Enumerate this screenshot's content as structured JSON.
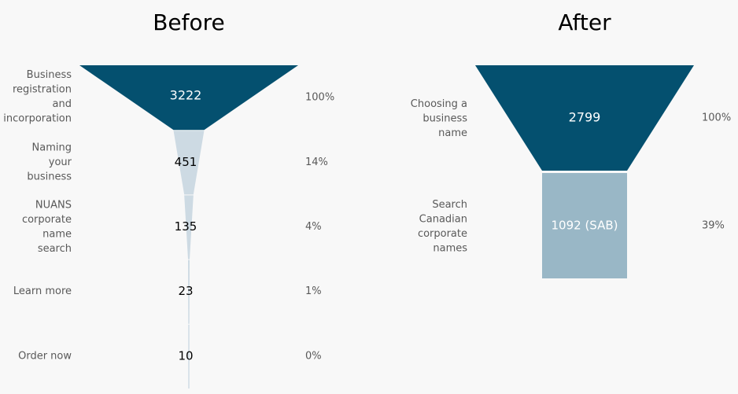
{
  "colors": {
    "dark": "#04506f",
    "light": "#cddae3",
    "medium": "#99b7c6",
    "label": "#595959",
    "background": "#f8f8f8"
  },
  "chart_data": [
    {
      "type": "funnel",
      "title": "Before",
      "stages": [
        {
          "label": "Business registration and incorporation",
          "label_lines": [
            "Business",
            "registration",
            "and",
            "incorporation"
          ],
          "value": 3222,
          "value_text": "3222",
          "percent": "100%",
          "color": "dark"
        },
        {
          "label": "Naming your business",
          "label_lines": [
            "Naming",
            "your",
            "business"
          ],
          "value": 451,
          "value_text": "451",
          "percent": "14%",
          "color": "light"
        },
        {
          "label": "NUANS corporate name search",
          "label_lines": [
            "NUANS",
            "corporate",
            "name",
            "search"
          ],
          "value": 135,
          "value_text": "135",
          "percent": "4%",
          "color": "light"
        },
        {
          "label": "Learn more",
          "label_lines": [
            "Learn more"
          ],
          "value": 23,
          "value_text": "23",
          "percent": "1%",
          "color": "light"
        },
        {
          "label": "Order now",
          "label_lines": [
            "Order now"
          ],
          "value": 10,
          "value_text": "10",
          "percent": "0%",
          "color": "light"
        }
      ]
    },
    {
      "type": "funnel",
      "title": "After",
      "stages": [
        {
          "label": "Choosing a business name",
          "label_lines": [
            "Choosing a",
            "business",
            "name"
          ],
          "value": 2799,
          "value_text": "2799",
          "percent": "100%",
          "color": "dark"
        },
        {
          "label": "Search Canadian corporate names",
          "label_lines": [
            "Search",
            "Canadian",
            "corporate",
            "names"
          ],
          "value": 1092,
          "value_text": "1092 (SAB)",
          "percent": "39%",
          "color": "medium"
        }
      ]
    }
  ]
}
